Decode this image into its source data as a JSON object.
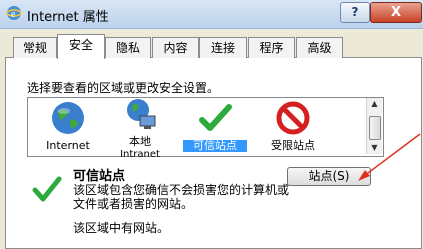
{
  "window": {
    "title": "Internet 属性",
    "help": "?",
    "close": "X"
  },
  "tabs": [
    {
      "label": "常规"
    },
    {
      "label": "安全",
      "active": true
    },
    {
      "label": "隐私"
    },
    {
      "label": "内容"
    },
    {
      "label": "连接"
    },
    {
      "label": "程序"
    },
    {
      "label": "高级"
    }
  ],
  "security": {
    "instruction": "选择要查看的区域或更改安全设置。",
    "zones": [
      {
        "label": "Internet",
        "icon": "globe-icon"
      },
      {
        "label": "本地",
        "label2": "Intranet",
        "icon": "local-intranet-icon"
      },
      {
        "label": "可信站点",
        "icon": "check-icon",
        "selected": true
      },
      {
        "label": "受限站点",
        "icon": "restricted-icon"
      }
    ],
    "selected_zone": {
      "title": "可信站点",
      "desc_line1": "该区域包含您确信不会损害您的计算机或",
      "desc_line2": "文件或者损害的网站。",
      "desc_line3": "该区域中有网站。"
    },
    "sites_button": "站点(S)"
  },
  "colors": {
    "selection": "#3399ff",
    "arrow": "#e03020",
    "check": "#2eaa3c"
  }
}
